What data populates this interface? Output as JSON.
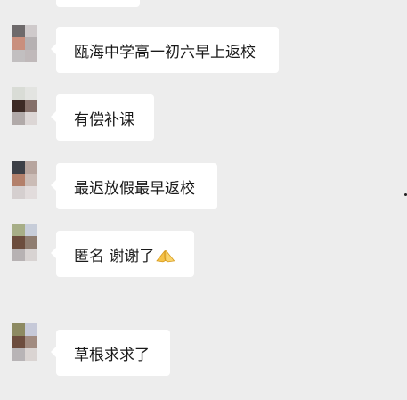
{
  "messages": [
    {
      "text": "瓯海中学高一初六早上返校"
    },
    {
      "text": "有偿补课"
    },
    {
      "text": "最迟放假最早返校"
    },
    {
      "text": "匿名 谢谢了"
    },
    {
      "text": "草根求求了"
    }
  ],
  "icons": {
    "message_4_emoji": "folded-hands-emoji"
  },
  "colors": {
    "background": "#ededed",
    "bubble": "#ffffff",
    "text": "#1a1a1a"
  }
}
